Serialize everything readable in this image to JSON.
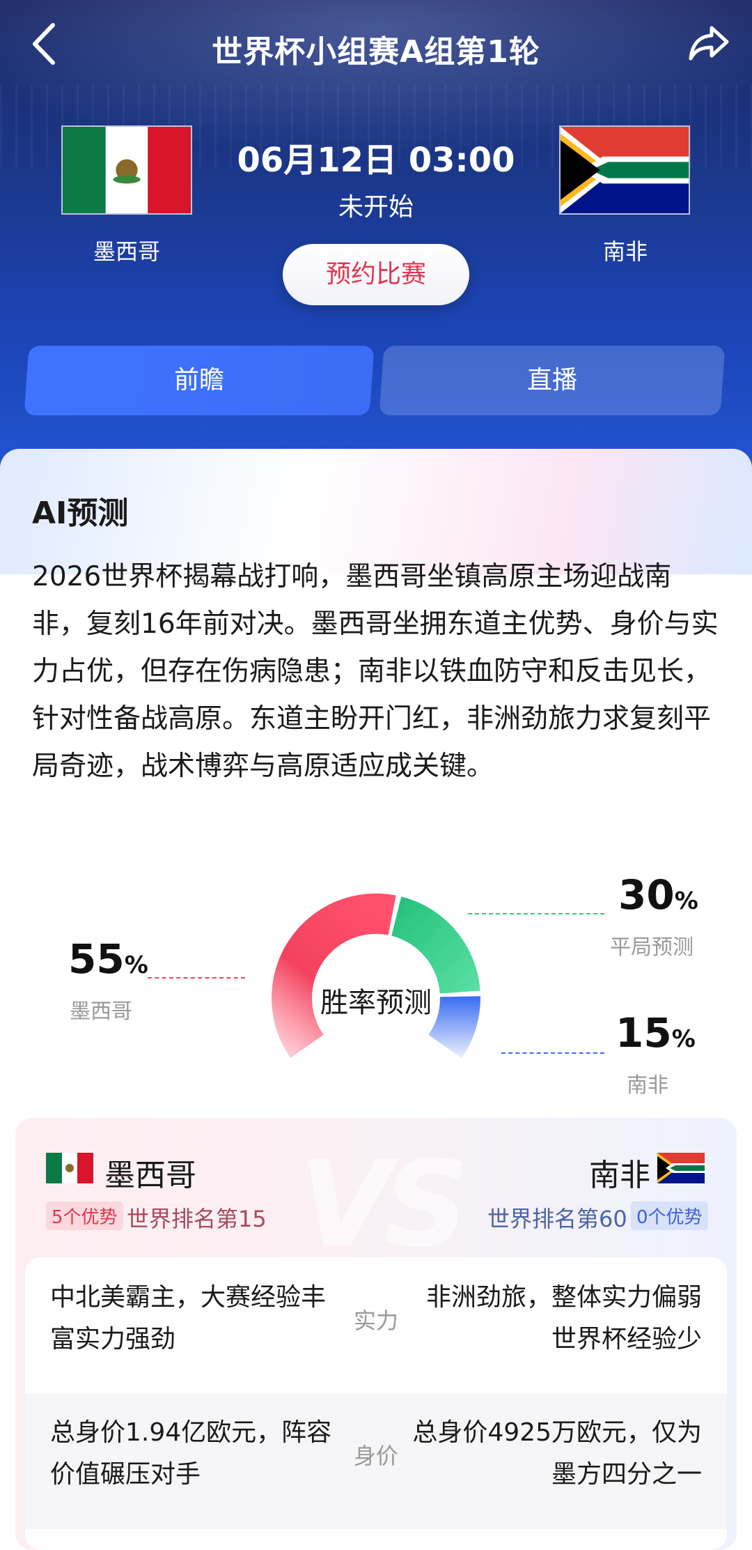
{
  "header": {
    "title": "世界杯小组赛A组第1轮",
    "datetime": "06月12日 03:00",
    "status": "未开始",
    "reserve_label": "预约比赛",
    "back_icon": "chevron-left-icon",
    "share_icon": "share-arrow-icon"
  },
  "teams": {
    "home": {
      "name": "墨西哥"
    },
    "away": {
      "name": "南非"
    }
  },
  "tabs": [
    {
      "label": "前瞻",
      "active": true
    },
    {
      "label": "直播",
      "active": false
    }
  ],
  "ai": {
    "title": "AI预测",
    "text": "2026世界杯揭幕战打响，墨西哥坐镇高原主场迎战南非，复刻16年前对决。墨西哥坐拥东道主优势、身价与实力占优，但存在伤病隐患；南非以铁血防守和反击见长，针对性备战高原。东道主盼开门红，非洲劲旅力求复刻平局奇迹，战术博弈与高原适应成关键。"
  },
  "prediction": {
    "center_label": "胜率预测",
    "home": {
      "value": "55",
      "unit": "%",
      "label": "墨西哥",
      "color": "#f3425e"
    },
    "draw": {
      "value": "30",
      "unit": "%",
      "label": "平局预测",
      "color": "#2fcb82"
    },
    "away": {
      "value": "15",
      "unit": "%",
      "label": "南非",
      "color": "#3a6cf2"
    }
  },
  "compare": {
    "home_badge": "5个优势",
    "home_rank": "世界排名第15",
    "away_rank": "世界排名第60",
    "away_badge": "0个优势",
    "rows": [
      {
        "left": "中北美霸主，大赛经验丰富实力强劲",
        "mid": "实力",
        "right": "非洲劲旅，整体实力偏弱世界杯经验少"
      },
      {
        "left": "总身价1.94亿欧元，阵容价值碾压对手",
        "mid": "身价",
        "right": "总身价4925万欧元，仅为墨方四分之一"
      }
    ]
  }
}
